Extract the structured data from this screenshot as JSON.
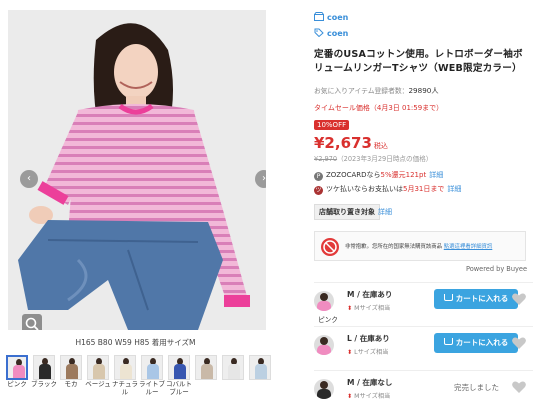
{
  "gallery": {
    "caption": "H165 B80 W59 H85 着用サイズM",
    "prev_arrow": "‹",
    "next_arrow": "›",
    "thumbnails": [
      {
        "label": "ピンク",
        "color": "#f08cc0",
        "active": true
      },
      {
        "label": "ブラック",
        "color": "#2a2a2a",
        "active": false
      },
      {
        "label": "モカ",
        "color": "#9c7a5e",
        "active": false
      },
      {
        "label": "ベージュ",
        "color": "#d8c7ad",
        "active": false
      },
      {
        "label": "ナチュラル",
        "color": "#ede4d2",
        "active": false
      },
      {
        "label": "ライトブルー",
        "color": "#a9c6e6",
        "active": false
      },
      {
        "label": "コバルトブルー",
        "color": "#3756b0",
        "active": false
      },
      {
        "label": "",
        "color": "#c9b9a8",
        "active": false
      },
      {
        "label": "",
        "color": "#e6e6e6",
        "active": false
      },
      {
        "label": "",
        "color": "#bcd0e2",
        "active": false
      }
    ]
  },
  "product": {
    "brand_1": "coen",
    "brand_2": "coen",
    "title": "定番のUSAコットン使用。レトロボーダー袖ボリュームリンガーTシャツ（WEB限定カラー）",
    "favorites_label": "お気に入りアイテム登録者数：",
    "favorites_count": "29890人",
    "timesale": "タイムセール価格（4月3日 01:59まで）",
    "off_badge": "10%OFF",
    "price": "¥2,673",
    "tax_label": "税込",
    "original_price": "¥2,970",
    "original_note": "（2023年3月29日時点の価格）",
    "zozocard_prefix": "ZOZOCARDなら",
    "zozocard_rate": "5%還元121pt",
    "zozocard_link": "詳細",
    "tsuke_prefix": "ツケ払いならお支払いは",
    "tsuke_date": "5月31日まで",
    "tsuke_link": "詳細",
    "store_tag": "店舗取り置き対象",
    "store_link": "詳細"
  },
  "buyee": {
    "notice": "非常抱歉。您所在的国家無法購買該商品",
    "link": "點選這裡看詳細資訊",
    "powered": "Powered by Buyee"
  },
  "variants": [
    {
      "color_label": "ピンク",
      "swatch": "#f08cc0",
      "size_status": "M / 在庫あり",
      "note": "Mサイズ相当",
      "action": "カートに入れる",
      "sold_out": false
    },
    {
      "color_label": "",
      "swatch": "#f08cc0",
      "size_status": "L / 在庫あり",
      "note": "Lサイズ相当",
      "action": "カートに入れる",
      "sold_out": false
    },
    {
      "color_label": "",
      "swatch": "#2a2a2a",
      "size_status": "M / 在庫なし",
      "note": "Mサイズ相当",
      "action": "完売しました",
      "sold_out": true
    }
  ],
  "colors": {
    "accent": "#3ba4e0",
    "sale_red": "#d9302e",
    "link_blue": "#3a8fd9"
  }
}
